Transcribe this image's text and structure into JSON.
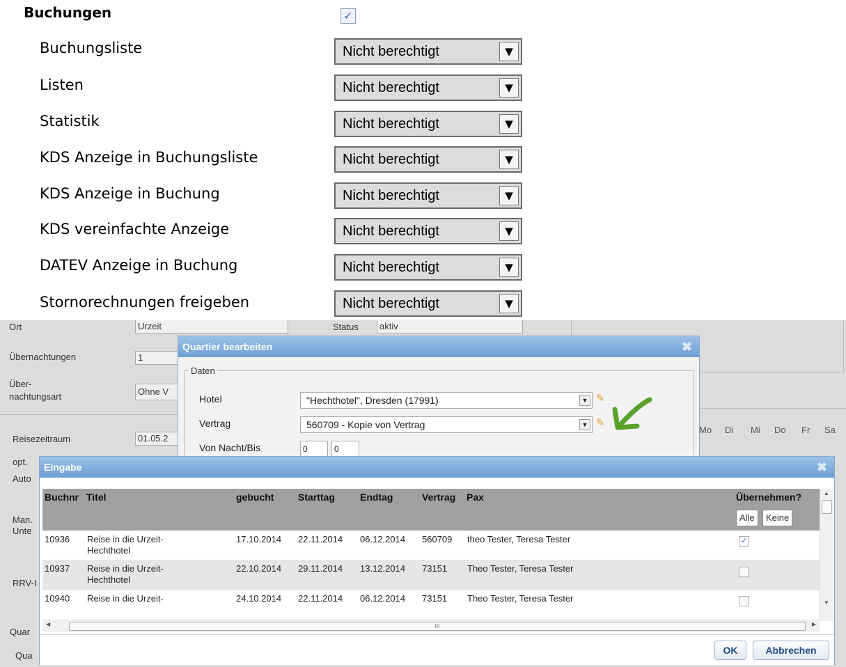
{
  "permissions": {
    "section_title": "Buchungen",
    "section_checked": "✓",
    "items": [
      {
        "label": "Buchungsliste",
        "value": "Nicht berechtigt"
      },
      {
        "label": "Listen",
        "value": "Nicht berechtigt"
      },
      {
        "label": "Statistik",
        "value": "Nicht berechtigt"
      },
      {
        "label": "KDS Anzeige in Buchungsliste",
        "value": "Nicht berechtigt"
      },
      {
        "label": "KDS Anzeige in Buchung",
        "value": "Nicht berechtigt"
      },
      {
        "label": "KDS vereinfachte Anzeige",
        "value": "Nicht berechtigt"
      },
      {
        "label": "DATEV Anzeige in Buchung",
        "value": "Nicht berechtigt"
      },
      {
        "label": "Stornorechnungen freigeben",
        "value": "Nicht berechtigt"
      }
    ]
  },
  "background_form": {
    "ort_label": "Ort",
    "ort_value": "Urzeit",
    "status_label": "Status",
    "status_value": "aktiv",
    "uebernachtungen_label": "Übernachtungen",
    "uebernachtungen_value": "1",
    "uebernachtungsart_label_1": "Über-",
    "uebernachtungsart_label_2": "nachtungsart",
    "uebernachtungsart_value": "Ohne V",
    "reisezeitraum_label": "Reisezeitraum",
    "reisezeitraum_value": "01.05.2",
    "opt_label": "opt.",
    "auto_label": "Auto",
    "man_label": "Man.",
    "unte_label": "Unte",
    "rrv_label": "RRV-I",
    "quar_label": "Quar",
    "qua_label": "Qua",
    "days": [
      "Mo",
      "Di",
      "Mi",
      "Do",
      "Fr",
      "Sa"
    ]
  },
  "quartier_dialog": {
    "title": "Quartier bearbeiten",
    "legend": "Daten",
    "hotel_label": "Hotel",
    "hotel_value": "\"Hechthotel\", Dresden (17991)",
    "vertrag_label": "Vertrag",
    "vertrag_value": "560709 - Kopie von  Vertrag",
    "von_nacht_label": "Von Nacht/Bis",
    "von_nacht_from": "0",
    "von_nacht_to": "0"
  },
  "eingabe_dialog": {
    "title": "Eingabe",
    "columns": [
      "Buchnr",
      "Titel",
      "gebucht",
      "Starttag",
      "Endtag",
      "Vertrag",
      "Pax",
      "Übernehmen?"
    ],
    "select_all": "Alle",
    "select_none": "Keine",
    "rows": [
      {
        "buchnr": "10936",
        "titel_1": "Reise in die Urzeit-",
        "titel_2": "Hechthotel",
        "gebucht": "17.10.2014",
        "starttag": "22.11.2014",
        "endtag": "06.12.2014",
        "vertrag": "560709",
        "pax": "theo Tester, Teresa Tester",
        "checked": "✓"
      },
      {
        "buchnr": "10937",
        "titel_1": "Reise in die Urzeit-",
        "titel_2": "Hechthotel",
        "gebucht": "22.10.2014",
        "starttag": "29.11.2014",
        "endtag": "13.12.2014",
        "vertrag": "73151",
        "pax": "Theo Tester, Teresa Tester",
        "checked": ""
      },
      {
        "buchnr": "10940",
        "titel_1": "Reise in die Urzeit-",
        "titel_2": "",
        "gebucht": "24.10.2014",
        "starttag": "22.11.2014",
        "endtag": "06.12.2014",
        "vertrag": "73151",
        "pax": "Theo Tester, Teresa Tester",
        "checked": ""
      }
    ],
    "ok_label": "OK",
    "cancel_label": "Abbrechen",
    "scroll_mark": "III"
  },
  "colors": {
    "dialog_header": "#7aa9d9",
    "accent_arrow": "#5aa02c"
  }
}
